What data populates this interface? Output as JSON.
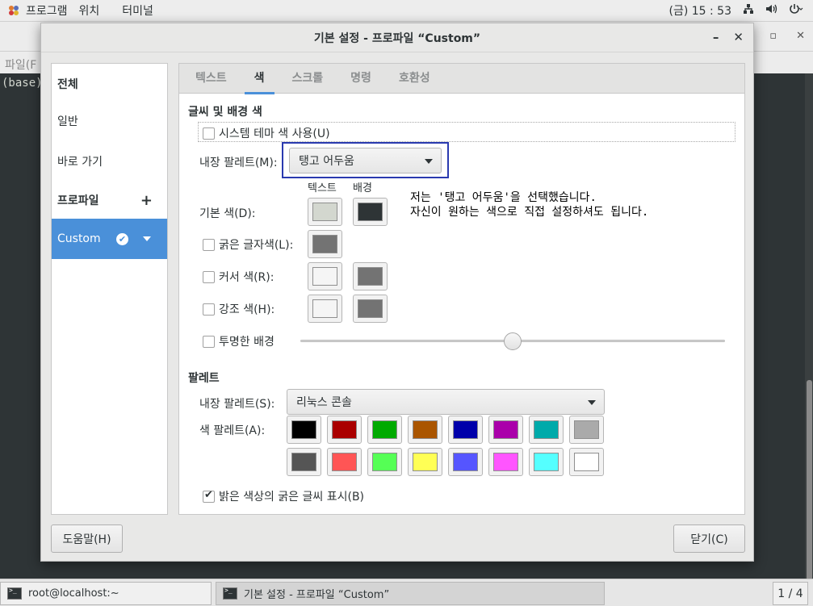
{
  "topbar": {
    "menu": [
      "프로그램",
      "위치",
      "터미널"
    ],
    "clock": "(금) 15 : 53",
    "icons": [
      "network-icon",
      "volume-icon",
      "power-icon"
    ]
  },
  "terminal": {
    "menu_text": "파일(F",
    "prompt": "(base)"
  },
  "dialog": {
    "title": "기본 설정 - 프로파일 “Custom”",
    "minimize": "–",
    "close": "✕"
  },
  "nav": {
    "all": "전체",
    "general": "일반",
    "shortcuts": "바로 가기",
    "profiles": "프로파일",
    "add": "+",
    "profile_name": "Custom"
  },
  "tabs": [
    "텍스트",
    "색",
    "스크롤",
    "명령",
    "호환성"
  ],
  "colors_section": {
    "title": "글씨 및 배경 색",
    "use_system_theme": "시스템 테마 색 사용(U)",
    "builtin_scheme_label": "내장 팔레트(M):",
    "builtin_scheme_value": "탱고 어두움",
    "col_text": "텍스트",
    "col_background": "배경",
    "default_color": "기본 색(D):",
    "bold_color": "굵은 글자색(L):",
    "cursor_color": "커서 색(R):",
    "highlight_color": "강조 색(H):",
    "transparent_bg": "투명한 배경",
    "transparency_level": 0.5
  },
  "annotation": {
    "line1": "저는 '탱고 어두움'을 선택했습니다.",
    "line2": "자신이 원하는 색으로 직접 설정하셔도 됩니다."
  },
  "palette_section": {
    "title": "팔레트",
    "builtin_label": "내장 팔레트(S):",
    "builtin_value": "리눅스 콘솔",
    "palette_label": "색 팔레트(A):",
    "row1": [
      "#000000",
      "#aa0000",
      "#00aa00",
      "#aa5500",
      "#0000aa",
      "#aa00aa",
      "#00aaaa",
      "#aaaaaa"
    ],
    "row2": [
      "#555555",
      "#ff5555",
      "#55ff55",
      "#ffff55",
      "#5555ff",
      "#ff55ff",
      "#55ffff",
      "#ffffff"
    ],
    "bold_bright": "밝은 색상의 굵은 글씨 표시(B)"
  },
  "swatch_colors": {
    "default_text": "#d3d7cf",
    "default_bg": "#2e3436",
    "bold": "#737373",
    "cursor_text": "#f5f5f5",
    "cursor_bg": "#737373",
    "highlight_text": "#f5f5f5",
    "highlight_bg": "#737373"
  },
  "buttons": {
    "help": "도움말(H)",
    "close": "닫기(C)"
  },
  "taskbar": {
    "task1": "root@localhost:~",
    "task2": "기본 설정 - 프로파일 “Custom”",
    "pager": "1 / 4"
  }
}
